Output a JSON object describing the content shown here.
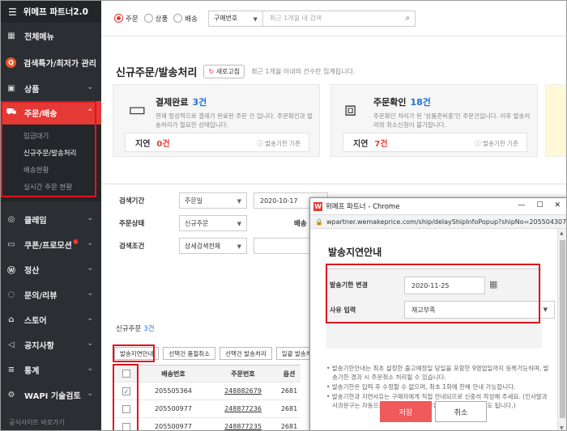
{
  "sidebar": {
    "title": "위메프 파트너2.0",
    "items": [
      {
        "label": "전체메뉴",
        "icon": "grid-icon"
      },
      {
        "label": "검색특가/최저가 관리",
        "icon": "search-icon"
      },
      {
        "label": "상품",
        "icon": "box-icon"
      },
      {
        "label": "주문/배송",
        "icon": "truck-icon"
      },
      {
        "label": "클레임",
        "icon": "claim-icon"
      },
      {
        "label": "쿠폰/프로모션",
        "icon": "coupon-icon"
      },
      {
        "label": "정산",
        "icon": "won-icon"
      },
      {
        "label": "문의/리뷰",
        "icon": "chat-icon"
      },
      {
        "label": "스토어",
        "icon": "store-icon"
      },
      {
        "label": "공지사항",
        "icon": "megaphone-icon"
      },
      {
        "label": "통계",
        "icon": "stats-icon"
      },
      {
        "label": "WAPI 기술검토",
        "icon": "gear-icon"
      }
    ],
    "submenu": [
      "입금대기",
      "신규주문/발송처리",
      "배송현황",
      "실시간 주문 현황"
    ],
    "footer": "공식사이트 바로가기"
  },
  "topbar": {
    "radios": [
      "주문",
      "상품",
      "배송"
    ],
    "search_type": "구매번호",
    "search_placeholder": "최근 1개월 내 검색"
  },
  "page": {
    "title": "신규주문/발송처리",
    "refresh": "새로고침",
    "note": "최근 1개월 이내의 건수만 집계됩니다."
  },
  "cards": [
    {
      "title": "결제완료",
      "count": "3건",
      "desc": "현재 정상적으로 결제가 완료된 주문 건 입니다. 주문확인과 발송처리가 필요한 상태입니다.",
      "delay_label": "지연",
      "delay_count": "0건",
      "delay_base": "발송기한 기준"
    },
    {
      "title": "주문확인",
      "count": "18건",
      "desc": "주문확인 처리가 된 '상품준비중'인 주문건입니다. 이후 발송처리와 취소신청이 불가합니다.",
      "delay_label": "지연",
      "delay_count": "7건",
      "delay_base": "발송기한 기준"
    }
  ],
  "filter": {
    "period_label": "검색기간",
    "period_type": "주문일",
    "period_date": "2020-10-17",
    "status_label": "주문상태",
    "status_value": "신규주문",
    "ship_label": "배송",
    "cond_label": "검색조건",
    "cond_value": "상세검색전체"
  },
  "list": {
    "count_label": "신규주문",
    "count": "3건",
    "buttons": [
      "발송지연안내",
      "선택건 품절취소",
      "선택건 발송처리",
      "일괄 발송처리"
    ],
    "headers": [
      "배송번호",
      "주문번호",
      "옵션"
    ],
    "rows": [
      {
        "ship": "205505364",
        "order": "248882679",
        "opt": "2681",
        "checked": true
      },
      {
        "ship": "205500977",
        "order": "248877236",
        "opt": "2681",
        "checked": false
      },
      {
        "ship": "205500977",
        "order": "248877235",
        "opt": "2681",
        "checked": false
      }
    ]
  },
  "popup": {
    "window_title": "위메프 파트너 - Chrome",
    "url": "wpartner.wemakeprice.com/ship/delayShipInfoPopup?shipNo=205504307",
    "title": "발송지연안내",
    "deadline_label": "발송기한 변경",
    "deadline_value": "2020-11-25",
    "reason_label": "사유 입력",
    "reason_value": "재고부족",
    "notes": [
      "발송기한안내는 최초 설정한 출고예정일 당일을 포함한 9영업일까지 등록가능하며, 발송기한 경과 시 주문취소 처리될 수 있습니다.",
      "발송기한은 입력 후 수정할 수 없으며, 최초 1회에 한해 안내 가능합니다.",
      "발송기한과 지연사유는 구매자에게 직접 안내되므로 신중히 작성해 주세요. (인사말과 사과문구는 자동으로 안내되므로 상세사유에 입력하지 않으셔도 됩니다.)"
    ],
    "save": "저장",
    "cancel": "취소"
  }
}
